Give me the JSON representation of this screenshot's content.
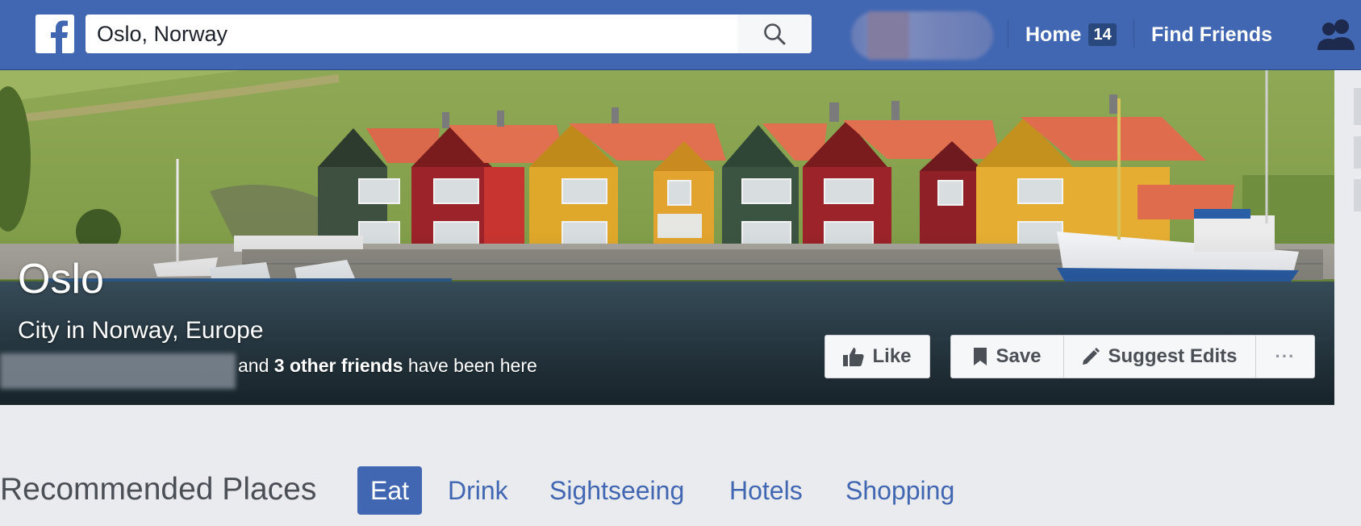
{
  "search": {
    "value": "Oslo, Norway",
    "placeholder": "Search"
  },
  "nav": {
    "home_label": "Home",
    "home_badge": "14",
    "find_friends_label": "Find Friends"
  },
  "page": {
    "title": "Oslo",
    "subtitle": "City in Norway, Europe",
    "friends_connector": "and",
    "friends_count_text": "3 other friends",
    "friends_suffix": "have been here"
  },
  "actions": {
    "like_label": "Like",
    "save_label": "Save",
    "suggest_label": "Suggest Edits",
    "more_label": "···"
  },
  "recommended": {
    "title": "Recommended Places",
    "tabs": [
      {
        "label": "Eat",
        "active": true
      },
      {
        "label": "Drink",
        "active": false
      },
      {
        "label": "Sightseeing",
        "active": false
      },
      {
        "label": "Hotels",
        "active": false
      },
      {
        "label": "Shopping",
        "active": false
      }
    ]
  },
  "colors": {
    "brand": "#4267b2",
    "brand_dark": "#29487d",
    "page_bg": "#e9ebee",
    "button_bg": "#f6f7f9"
  },
  "icons": {
    "logo": "facebook-f-logo",
    "search": "magnifier-icon",
    "friends": "friend-requests-icon",
    "like": "thumbs-up-icon",
    "save": "bookmark-icon",
    "suggest": "pencil-icon"
  }
}
